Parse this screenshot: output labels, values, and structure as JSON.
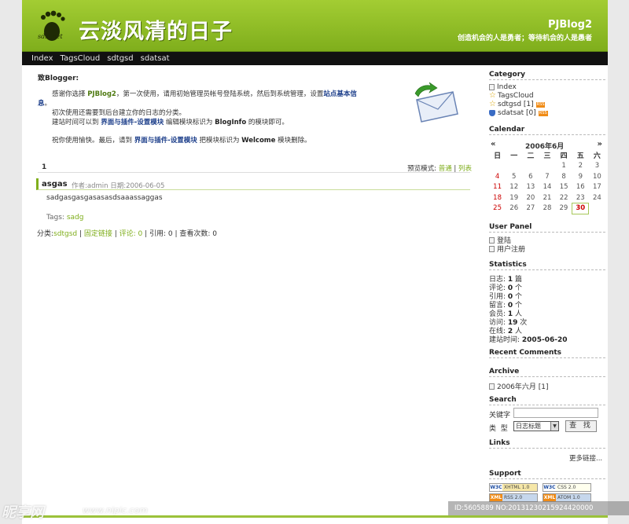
{
  "header": {
    "logo_text": "sdsl.net",
    "site_title": "云淡风清的日子",
    "brand": "PJBlog2",
    "motto": "创造机会的人是勇者；等待机会的人是愚者"
  },
  "nav": {
    "items": [
      "Index",
      "TagsCloud",
      "sdtgsd",
      "sdatsat"
    ]
  },
  "notice": {
    "title": "致Blogger:",
    "line1_a": "感谢你选择 ",
    "line1_brand": "PJBlog2",
    "line1_b": "，第一次使用，请用初始管理员帐号登陆系统，然后到系统管理，设置",
    "line1_link": "站点基本信",
    "line1_link2": "息",
    "line1_end": "。",
    "line2": "初次使用还需要到后台建立你的日志的分类。",
    "line3_a": "建站时间可以到 ",
    "line3_link": "界面与插件-设置模块",
    "line3_b": " 编辑模块标识为 ",
    "line3_key": "BlogInfo",
    "line3_c": " 的模块即可。",
    "line4_a": "祝你使用愉快。最后，请到 ",
    "line4_link": "界面与插件-设置模块",
    "line4_b": " 把模块标识为 ",
    "line4_key": "Welcome",
    "line4_c": " 模块删除。"
  },
  "pager": {
    "page": "1",
    "view_label": "预览模式: ",
    "view_normal": "普通",
    "sep": " | ",
    "view_list": "列表"
  },
  "post": {
    "title": "asgas",
    "meta": "作者:admin 日期:2006-06-05",
    "body": "sadgasgasgasasasdsaaassaggas",
    "tags_label": "Tags: ",
    "tag": "sadg",
    "foot_category_label": "分类:",
    "foot_category": "sdtgsd",
    "foot_sep1": " | ",
    "foot_permalink": "固定链接",
    "foot_sep2": " | ",
    "foot_comments": "评论: 0",
    "foot_rest": " | 引用: 0 | 查看次数: 0"
  },
  "sidebar": {
    "category_title": "Category",
    "categories": [
      "Index",
      "TagsCloud",
      "sdtgsd [1]",
      "sdatsat [0]"
    ],
    "rss_label": "RSS",
    "calendar_title": "Calendar",
    "cal_prev": "«",
    "cal_next": "»",
    "cal_month": "2006年6月",
    "weekdays": [
      "日",
      "一",
      "二",
      "三",
      "四",
      "五",
      "六"
    ],
    "weeks": [
      [
        "",
        "",
        "",
        "",
        "1",
        "2",
        "3"
      ],
      [
        "4",
        "5",
        "6",
        "7",
        "8",
        "9",
        "10"
      ],
      [
        "11",
        "12",
        "13",
        "14",
        "15",
        "16",
        "17"
      ],
      [
        "18",
        "19",
        "20",
        "21",
        "22",
        "23",
        "24"
      ],
      [
        "25",
        "26",
        "27",
        "28",
        "29",
        "30",
        ""
      ]
    ],
    "today": "30",
    "userpanel_title": "User Panel",
    "userpanel_items": [
      "登陆",
      "用户注册"
    ],
    "statistics_title": "Statistics",
    "stats": [
      {
        "label": "日志: ",
        "value": "1",
        "unit": " 篇"
      },
      {
        "label": "评论: ",
        "value": "0",
        "unit": " 个"
      },
      {
        "label": "引用: ",
        "value": "0",
        "unit": " 个"
      },
      {
        "label": "留言: ",
        "value": "0",
        "unit": " 个"
      },
      {
        "label": "会员: ",
        "value": "1",
        "unit": " 人"
      },
      {
        "label": "访问: ",
        "value": "19",
        "unit": " 次"
      },
      {
        "label": "在线: ",
        "value": "2",
        "unit": " 人"
      },
      {
        "label": "建站时间: ",
        "value": "2005-06-20",
        "unit": ""
      }
    ],
    "recent_comments_title": "Recent Comments",
    "archive_title": "Archive",
    "archive_items": [
      "2006年六月 [1]"
    ],
    "search_title": "Search",
    "search_keyword_label": "关键字",
    "search_type_label": "类  型",
    "search_type_value": "日志标题",
    "search_button": "查 找",
    "links_title": "Links",
    "more_links": "更多链接...",
    "support_title": "Support",
    "badges": [
      "XHTML 1.0",
      "CSS 2.0",
      "RSS 2.0",
      "ATOM 1.0"
    ]
  },
  "watermark": {
    "logo": "昵享网",
    "url": "www.nipic.com",
    "id": "ID:5605889 NO:20131230215924420000"
  }
}
